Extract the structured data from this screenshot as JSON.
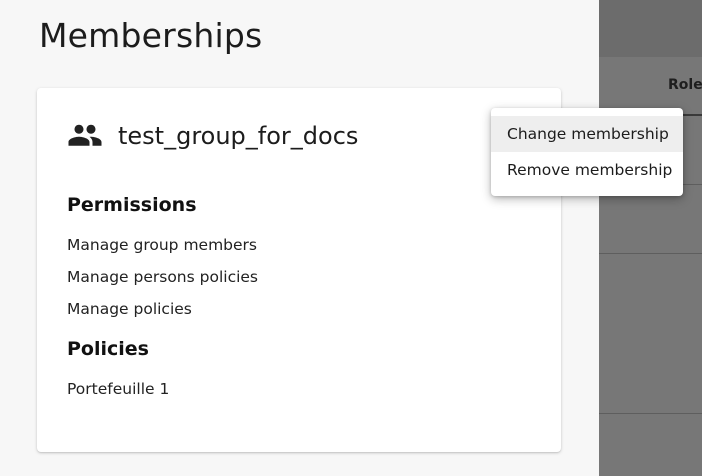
{
  "drawer": {
    "title": "Memberships"
  },
  "membership_card": {
    "group_icon": "group-icon",
    "group_name": "test_group_for_docs",
    "permissions_heading": "Permissions",
    "permissions": [
      "Manage group members",
      "Manage persons policies",
      "Manage policies"
    ],
    "policies_heading": "Policies",
    "policies": [
      "Portefeuille 1"
    ]
  },
  "context_menu": {
    "items": [
      "Change membership",
      "Remove membership"
    ]
  },
  "background_table": {
    "partial_header": "r",
    "role_header": "Role"
  },
  "colors": {
    "drawer_bg": "#f7f7f7",
    "card_bg": "#ffffff",
    "backdrop": "#777777",
    "menu_highlight": "#eeeeee"
  }
}
